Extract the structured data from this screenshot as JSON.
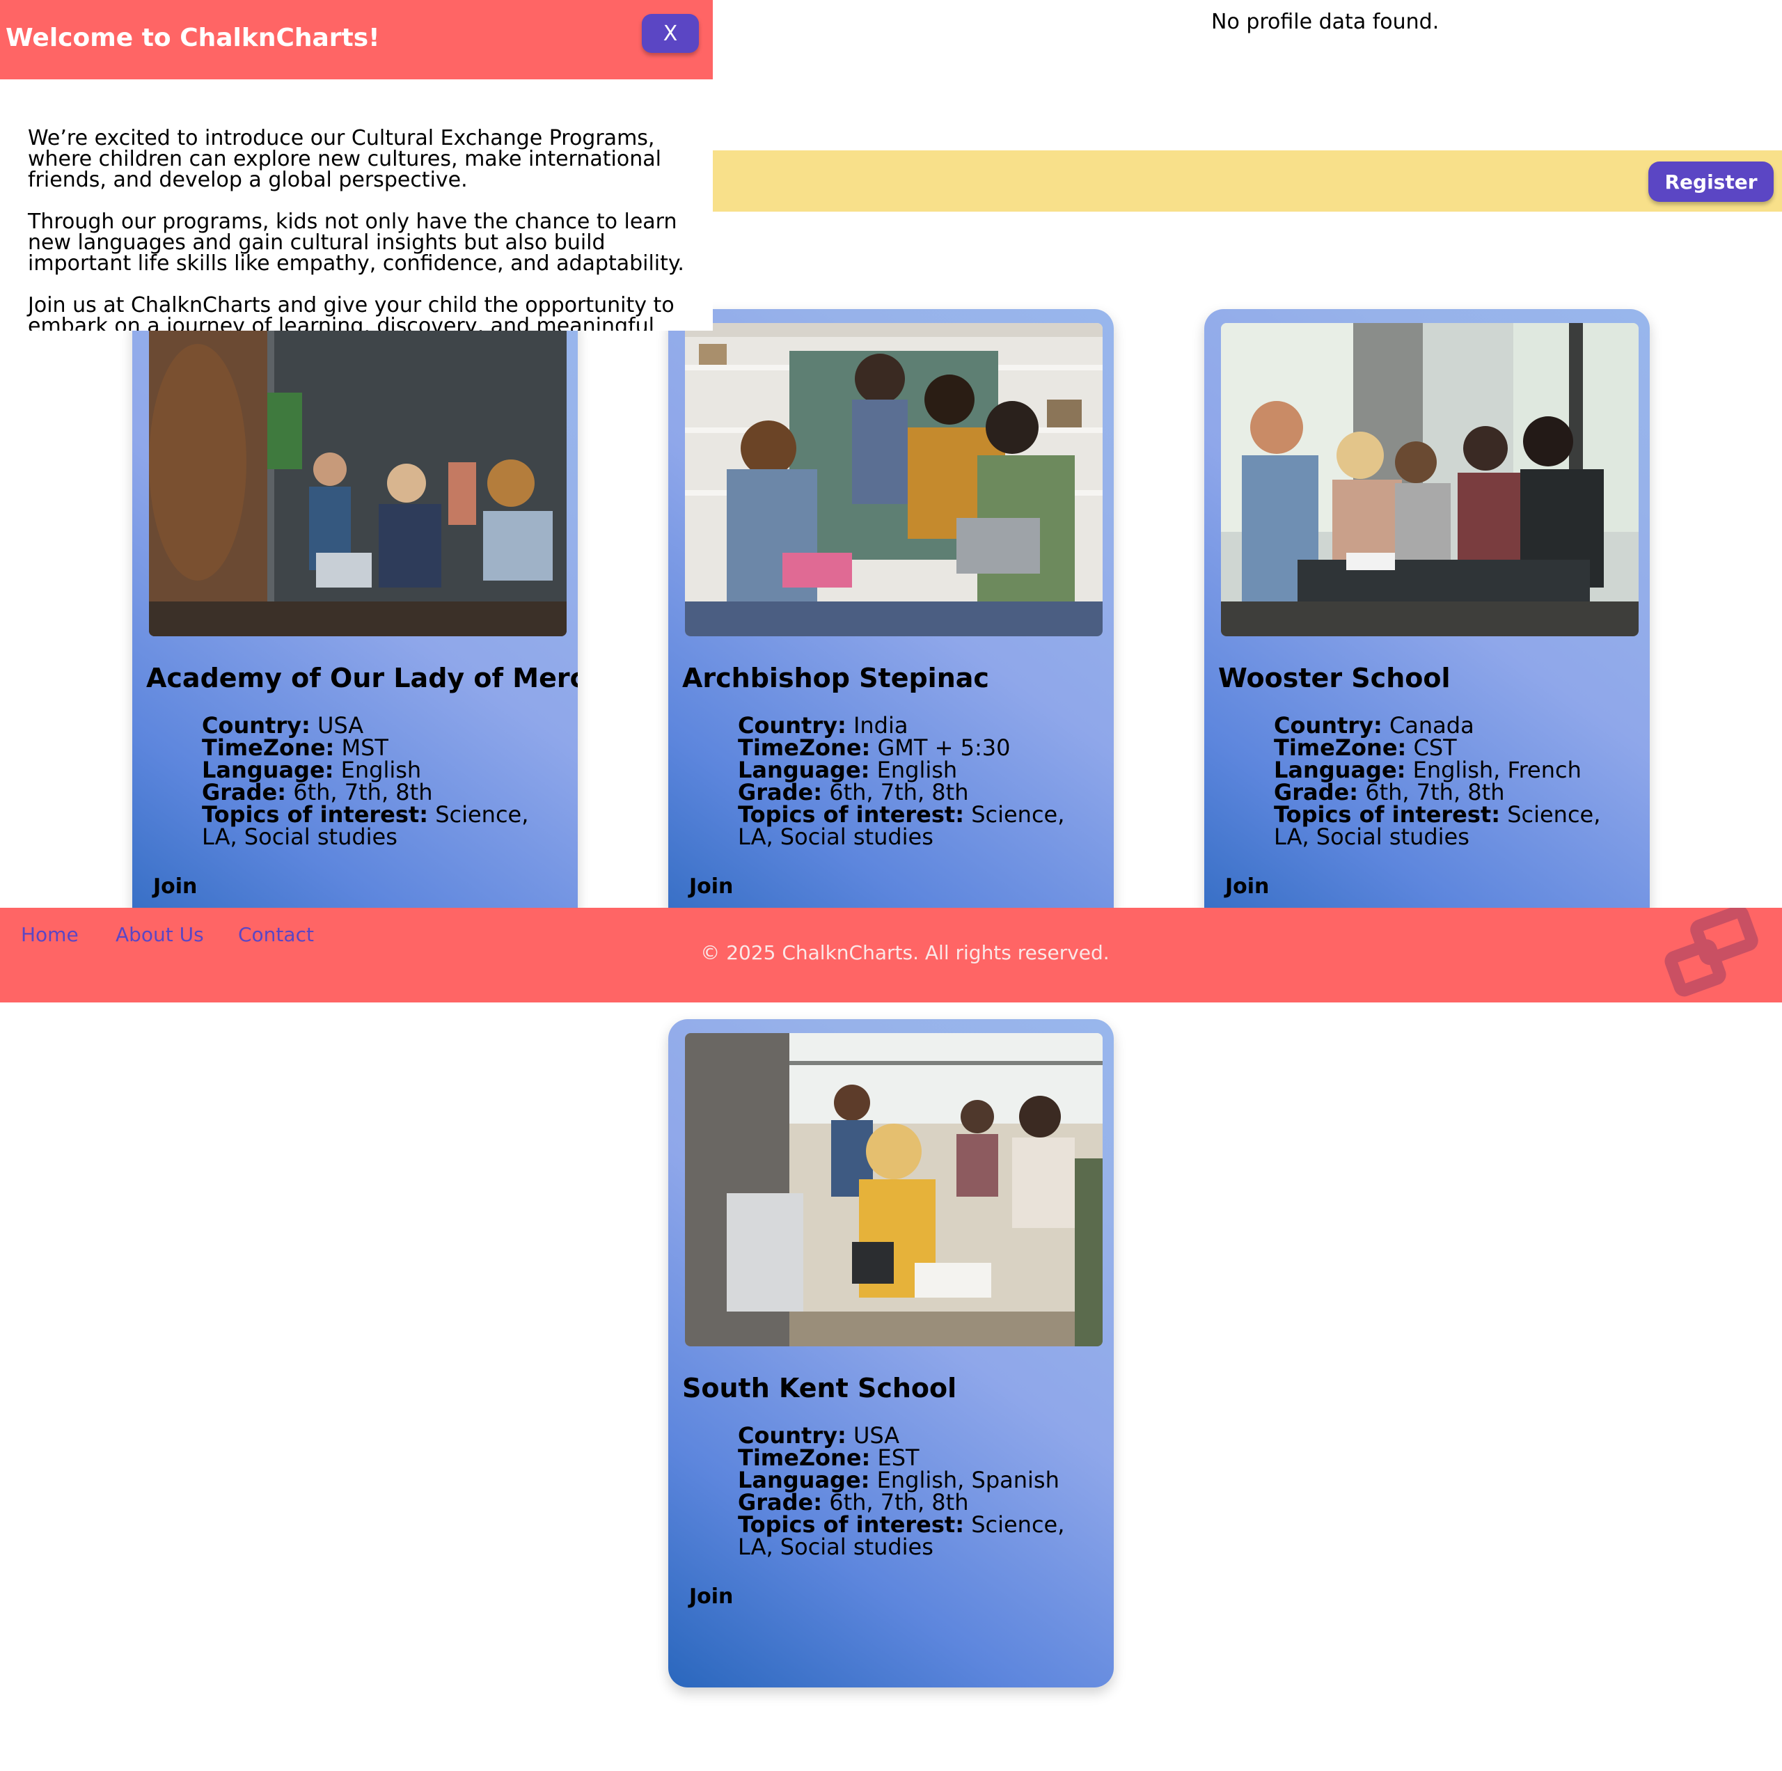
{
  "profile": {
    "message": "No profile data found."
  },
  "banner": {
    "register_label": "Register"
  },
  "popup": {
    "title": "Welcome to ChalknCharts!",
    "close_label": "X",
    "paragraphs": [
      "We’re excited to introduce our Cultural Exchange Programs, where children can explore new cultures, make international friends, and develop a global perspective.",
      "Through our programs, kids not only have the chance to learn new languages and gain cultural insights but also build important life skills like empathy, confidence, and adaptability.",
      "Join us at ChalknCharts and give your child the opportunity to embark on a journey of learning, discovery, and meaningful"
    ]
  },
  "labels": {
    "country": "Country:",
    "timezone": "TimeZone:",
    "language": "Language:",
    "grade": "Grade:",
    "topics": "Topics of interest:"
  },
  "schools": [
    {
      "name": "Academy of Our Lady of Mercy",
      "country": "USA",
      "timezone": "MST",
      "language": "English",
      "grade": "6th, 7th, 8th",
      "topics": "Science, LA, Social studies",
      "join_label": "Join"
    },
    {
      "name": "Archbishop Stepinac",
      "country": "India",
      "timezone": "GMT + 5:30",
      "language": "English",
      "grade": "6th, 7th, 8th",
      "topics": "Science, LA, Social studies",
      "join_label": "Join"
    },
    {
      "name": "Wooster School",
      "country": "Canada",
      "timezone": "CST",
      "language": "English, French",
      "grade": "6th, 7th, 8th",
      "topics": "Science, LA, Social studies",
      "join_label": "Join"
    },
    {
      "name": "South Kent School",
      "country": "USA",
      "timezone": "EST",
      "language": "English, Spanish",
      "grade": "6th, 7th, 8th",
      "topics": "Science, LA, Social studies",
      "join_label": "Join"
    }
  ],
  "footer": {
    "links": [
      "Home",
      "About Us",
      "Contact"
    ],
    "copyright": "© 2025 ChalknCharts. All rights reserved."
  },
  "colors": {
    "header": "#ff6565",
    "accent": "#5b46c4",
    "banner": "#f8e08a"
  }
}
